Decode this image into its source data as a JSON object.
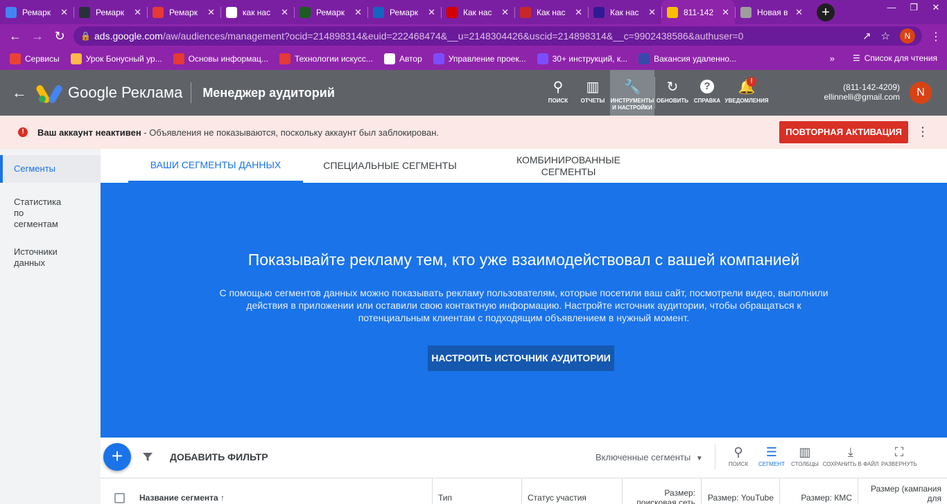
{
  "browser": {
    "tabs": [
      {
        "title": "Ремарк",
        "icon": "docs-icon",
        "color": "#4285f4"
      },
      {
        "title": "Ремарк",
        "icon": "mountain-icon",
        "color": "#263238"
      },
      {
        "title": "Ремарк",
        "icon": "t-icon",
        "color": "#e53935"
      },
      {
        "title": "как нас",
        "icon": "google-icon",
        "color": "#ffffff"
      },
      {
        "title": "Ремарк",
        "icon": "i-icon",
        "color": "#1b5e20"
      },
      {
        "title": "Ремарк",
        "icon": "square-icon",
        "color": "#1565c0"
      },
      {
        "title": "Как нас",
        "icon": "d-icon",
        "color": "#d50000"
      },
      {
        "title": "Как нас",
        "icon": "circle-icon",
        "color": "#c62828"
      },
      {
        "title": "Как нас",
        "icon": "cursor-icon",
        "color": "#311b92"
      },
      {
        "title": "811-142",
        "icon": "ads-icon",
        "color": "#fbbc04"
      },
      {
        "title": "Новая в",
        "icon": "chrome-icon",
        "color": "#9e9e9e"
      }
    ],
    "close_glyph": "✕",
    "new_tab_glyph": "+",
    "url_domain": "ads.google.com",
    "url_rest": "/aw/audiences/management?ocid=214898314&euid=222468474&__u=2148304426&uscid=214898314&__c=9902438586&authuser=0",
    "profile_letter": "N",
    "bookmarks": [
      {
        "label": "Сервисы",
        "color": "#ea4335"
      },
      {
        "label": "Урок Бонусный ур...",
        "color": "#ffb74d"
      },
      {
        "label": "Основы информац...",
        "color": "#e53935"
      },
      {
        "label": "Технологии искусс...",
        "color": "#e53935"
      },
      {
        "label": "Автор",
        "color": "#ffffff"
      },
      {
        "label": "Управление проек...",
        "color": "#7c4dff"
      },
      {
        "label": "30+ инструкций, к...",
        "color": "#7c4dff"
      },
      {
        "label": "Вакансия удаленно...",
        "color": "#3949ab"
      }
    ],
    "reading_list": "Список для чтения"
  },
  "header": {
    "brand": "Google Реклама",
    "title": "Менеджер аудиторий",
    "icons": [
      {
        "label": "ПОИСК",
        "icon": "search-icon"
      },
      {
        "label": "ОТЧЕТЫ",
        "icon": "reports-icon"
      },
      {
        "label": "ИНСТРУМЕНТЫ И НАСТРОЙКИ",
        "icon": "wrench-icon"
      },
      {
        "label": "ОБНОВИТЬ",
        "icon": "refresh-icon"
      },
      {
        "label": "СПРАВКА",
        "icon": "help-icon"
      },
      {
        "label": "УВЕДОМЛЕНИЯ",
        "icon": "bell-icon"
      }
    ],
    "notif_badge": "!",
    "account_phone": "(811-142-4209)",
    "account_email": "ellinnelli@gmail.com",
    "avatar_letter": "N"
  },
  "warning": {
    "bold": "Ваш аккаунт неактивен",
    "text": " - Объявления не показываются, поскольку аккаунт был заблокирован.",
    "button": "ПОВТОРНАЯ АКТИВАЦИЯ"
  },
  "sidenav": {
    "items": [
      "Сегменты",
      "Статистика по сегментам",
      "Источники данных"
    ]
  },
  "segment_tabs": [
    "ВАШИ СЕГМЕНТЫ ДАННЫХ",
    "СПЕЦИАЛЬНЫЕ СЕГМЕНТЫ",
    "КОМБИНИРОВАННЫЕ СЕГМЕНТЫ"
  ],
  "promo": {
    "title": "Показывайте рекламу тем, кто уже взаимодействовал с вашей компанией",
    "body": "С помощью сегментов данных можно показывать рекламу пользователям, которые посетили ваш сайт, посмотрели видео, выполнили действия в приложении или оставили свою контактную информацию. Настройте источник аудитории, чтобы обращаться к потенциальным клиентам с подходящим объявлением в нужный момент.",
    "button": "НАСТРОИТЬ ИСТОЧНИК АУДИТОРИИ"
  },
  "filterbar": {
    "add_filter": "ДОБАВИТЬ ФИЛЬТР",
    "segments_select": "Включенные сегменты",
    "tools": [
      {
        "label": "ПОИСК",
        "icon": "search-icon"
      },
      {
        "label": "СЕГМЕНТ",
        "icon": "segment-icon"
      },
      {
        "label": "СТОЛБЦЫ",
        "icon": "columns-icon"
      },
      {
        "label": "СОХРАНИТЬ В ФАЙЛ",
        "icon": "download-icon"
      },
      {
        "label": "РАЗВЕРНУТЬ",
        "icon": "fullscreen-icon"
      }
    ]
  },
  "table": {
    "columns": [
      "Название сегмента",
      "Тип",
      "Статус участия",
      "Размер: поисковая сеть",
      "Размер: YouTube",
      "Размер: КМС",
      "Размер (кампания для"
    ]
  }
}
